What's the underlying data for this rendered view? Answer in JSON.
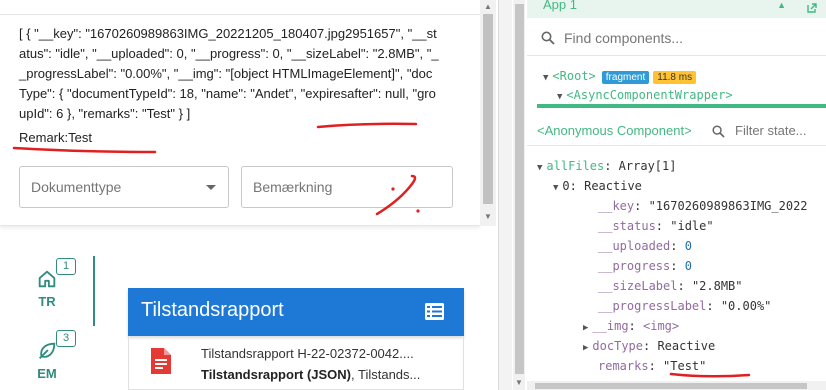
{
  "upload_card": {
    "json_text": "[ { \"__key\": \"1670260989863IMG_20221205_180407.jpg2951657\", \"__status\": \"idle\", \"__uploaded\": 0, \"__progress\": 0, \"__sizeLabel\": \"2.8MB\", \"__progressLabel\": \"0.00%\", \"__img\": \"[object HTMLImageElement]\", \"docType\": { \"documentTypeId\": 18, \"name\": \"Andet\", \"expiresafter\": null, \"groupId\": 6 }, \"remarks\": \"Test\" } ]",
    "remark_line": "Remark:Test",
    "doc_type_select": {
      "placeholder": "Dokumenttype"
    },
    "remark_input": {
      "placeholder": "Bemærkning"
    }
  },
  "left_nav": {
    "items": [
      {
        "icon": "home-icon",
        "label": "TR",
        "badge": "1"
      },
      {
        "icon": "eco-icon",
        "label": "EM",
        "badge": "3"
      }
    ]
  },
  "report_panel": {
    "title": "Tilstandsrapport",
    "header_icon": "list-icon",
    "doc": {
      "icon": "pdf-file-icon",
      "line1": "Tilstandsrapport H-22-02372-0042....",
      "line2_bold": "Tilstandsrapport (JSON)",
      "line2_rest": ", Tilstands..."
    }
  },
  "devtools": {
    "app_title": "App 1",
    "search_placeholder": "Find components...",
    "tree": {
      "root": "<Root>",
      "fragment_badge": "fragment",
      "time_badge": "11.8 ms",
      "child": "<AsyncComponentWrapper>"
    },
    "inspector": {
      "component": "<Anonymous Component>",
      "filter_placeholder": "Filter state..."
    },
    "state": {
      "allFiles_key": "allFiles",
      "allFiles_val": "Array[1]",
      "item0_key": "0",
      "item0_val": "Reactive",
      "fields": [
        {
          "key": "__key",
          "val": "\"1670260989863IMG_2022"
        },
        {
          "key": "__status",
          "val": "\"idle\""
        },
        {
          "key": "__uploaded",
          "val": "0"
        },
        {
          "key": "__progress",
          "val": "0"
        },
        {
          "key": "__sizeLabel",
          "val": "\"2.8MB\""
        },
        {
          "key": "__progressLabel",
          "val": "\"0.00%\""
        }
      ],
      "img_key": "__img",
      "img_val": "<img>",
      "docType_key": "docType",
      "docType_val": "Reactive",
      "remarks_key": "remarks",
      "remarks_val": "\"Test\""
    }
  },
  "colors": {
    "vue_green": "#42b883",
    "report_blue": "#1d78d6",
    "annotation_red": "#e02020",
    "nav_teal": "#2f8c7f"
  }
}
